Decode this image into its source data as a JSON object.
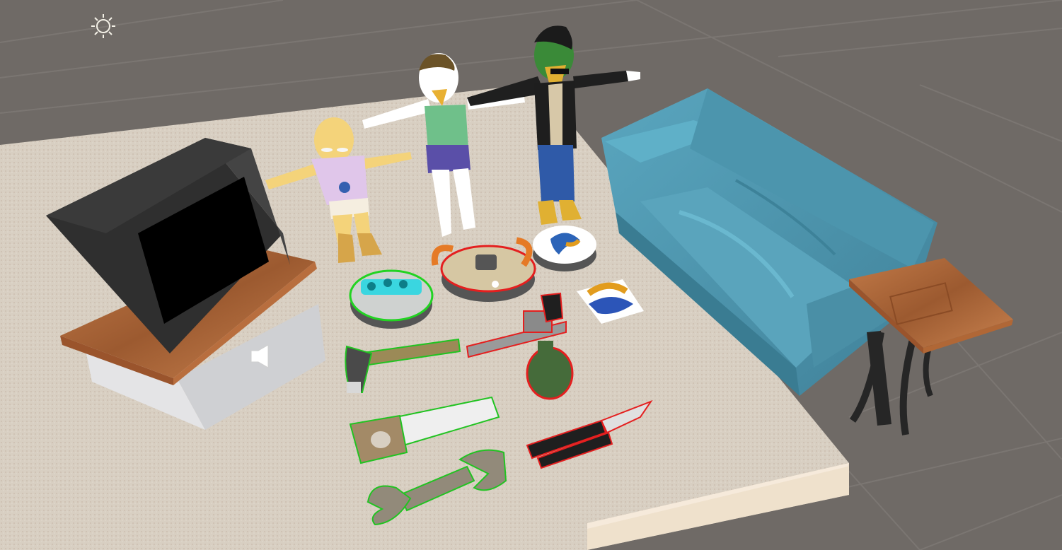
{
  "app": {
    "view": "scene-viewport",
    "background_color": "#6f6a66",
    "grid_color": "#7b7672"
  },
  "gizmos": [
    {
      "type": "directional-light",
      "icon": "sun-icon",
      "color": "#f3f0e6"
    },
    {
      "type": "audio-source",
      "icon": "speaker-icon",
      "color": "#ffffff"
    }
  ],
  "scene_objects": [
    {
      "id": "rug",
      "color": "#d8cfc2"
    },
    {
      "id": "tv-stand",
      "color": "#e4e4e6",
      "top_color": "#b06b3e"
    },
    {
      "id": "crt-tv",
      "color": "#2d2d2d",
      "screen_color": "#000000"
    },
    {
      "id": "couch",
      "color": "#4f98b0"
    },
    {
      "id": "side-table",
      "color": "#b4683c",
      "legs_color": "#262626"
    },
    {
      "id": "child-character",
      "color": "#f4d37a"
    },
    {
      "id": "woman-character",
      "color": "#ffffff"
    },
    {
      "id": "biker-character",
      "color": "#1e1e1e"
    },
    {
      "id": "robot-vacuum-green",
      "outline_color": "#22d322"
    },
    {
      "id": "robot-vacuum-red",
      "outline_color": "#e41f1f"
    },
    {
      "id": "robot-vacuum-blue",
      "color": "#2c64b8"
    },
    {
      "id": "logo-card",
      "color": "#ffffff"
    },
    {
      "id": "hammer",
      "outline_color": "#22c322"
    },
    {
      "id": "revolver",
      "outline_color": "#e41f1f"
    },
    {
      "id": "grenade",
      "outline_color": "#e41f1f"
    },
    {
      "id": "saw",
      "outline_color": "#22c322"
    },
    {
      "id": "butterfly-knife",
      "outline_color": "#e41f1f"
    },
    {
      "id": "wrench",
      "outline_color": "#22c322"
    }
  ]
}
